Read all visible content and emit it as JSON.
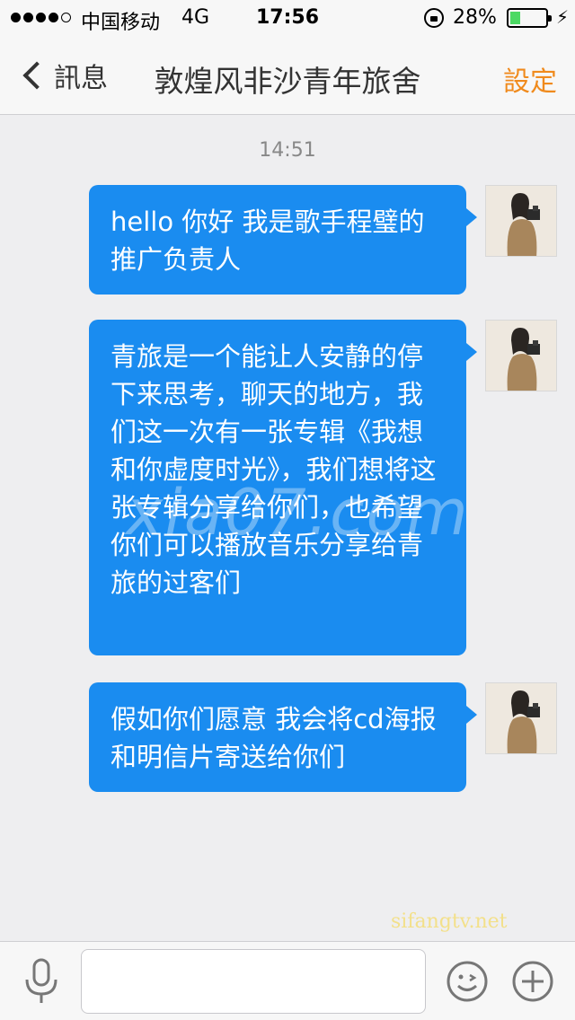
{
  "status_bar": {
    "signal_bars": 5,
    "signal_filled": 4,
    "carrier": "中国移动",
    "network": "4G",
    "time": "17:56",
    "battery_percent_text": "28%",
    "battery_level": 0.28,
    "battery_color": "#4cd964"
  },
  "nav": {
    "back_label": "訊息",
    "title": "敦煌风非沙青年旅舍",
    "settings_label": "設定",
    "accent_color": "#f08a1c"
  },
  "chat": {
    "timestamp": "14:51",
    "bubble_color": "#1a8cf0",
    "messages": [
      {
        "sender": "self",
        "text": "hello 你好 我是歌手程璧的推广负责人"
      },
      {
        "sender": "self",
        "text": "青旅是一个能让人安静的停下来思考，聊天的地方，我们这一次有一张专辑《我想和你虚度时光》，我们想将这张专辑分享给你们，也希望你们可以播放音乐分享给青旅的过客们"
      },
      {
        "sender": "self",
        "text": "假如你们愿意 我会将cd海报和明信片寄送给你们"
      }
    ]
  },
  "watermarks": {
    "center": "xia07.com",
    "bottom": "sifangtv.net"
  },
  "input_bar": {
    "input_value": "",
    "icons": [
      "microphone-icon",
      "emoji-icon",
      "plus-icon"
    ]
  }
}
